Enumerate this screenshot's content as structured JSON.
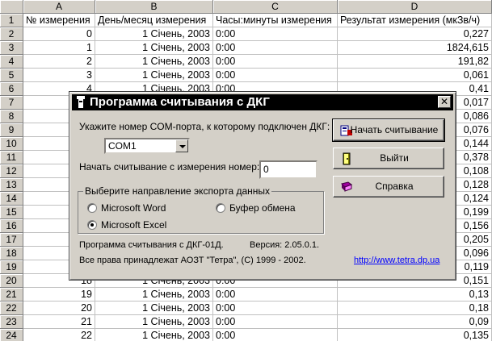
{
  "sheet": {
    "corner": "",
    "columns": [
      "A",
      "B",
      "C",
      "D"
    ],
    "headers": {
      "row_number": "1",
      "a": "№ измерения",
      "b": "День/месяц измерения",
      "c": "Часы:минуты измерения",
      "d": "Результат измерения (мкЗв/ч)"
    },
    "rows": [
      {
        "n": "2",
        "a": "0",
        "b": "1 Січень, 2003",
        "c": "0:00",
        "d": "0,227"
      },
      {
        "n": "3",
        "a": "1",
        "b": "1 Січень, 2003",
        "c": "0:00",
        "d": "1824,615"
      },
      {
        "n": "4",
        "a": "2",
        "b": "1 Січень, 2003",
        "c": "0:00",
        "d": "191,82"
      },
      {
        "n": "5",
        "a": "3",
        "b": "1 Січень, 2003",
        "c": "0:00",
        "d": "0,061"
      },
      {
        "n": "6",
        "a": "4",
        "b": "1 Січень, 2003",
        "c": "0:00",
        "d": "0,41"
      },
      {
        "n": "7",
        "a": "",
        "b": "",
        "c": "",
        "d": "0,017"
      },
      {
        "n": "8",
        "a": "",
        "b": "",
        "c": "",
        "d": "0,086"
      },
      {
        "n": "9",
        "a": "",
        "b": "",
        "c": "",
        "d": "0,076"
      },
      {
        "n": "10",
        "a": "",
        "b": "",
        "c": "",
        "d": "0,144"
      },
      {
        "n": "11",
        "a": "",
        "b": "",
        "c": "",
        "d": "0,378"
      },
      {
        "n": "12",
        "a": "",
        "b": "",
        "c": "",
        "d": "0,108"
      },
      {
        "n": "13",
        "a": "",
        "b": "",
        "c": "",
        "d": "0,128"
      },
      {
        "n": "14",
        "a": "",
        "b": "",
        "c": "",
        "d": "0,124"
      },
      {
        "n": "15",
        "a": "",
        "b": "",
        "c": "",
        "d": "0,199"
      },
      {
        "n": "16",
        "a": "",
        "b": "",
        "c": "",
        "d": "0,156"
      },
      {
        "n": "17",
        "a": "",
        "b": "",
        "c": "",
        "d": "0,205"
      },
      {
        "n": "18",
        "a": "",
        "b": "",
        "c": "",
        "d": "0,096"
      },
      {
        "n": "19",
        "a": "",
        "b": "",
        "c": "",
        "d": "0,119"
      },
      {
        "n": "20",
        "a": "18",
        "b": "1 Січень, 2003",
        "c": "0:00",
        "d": "0,151"
      },
      {
        "n": "21",
        "a": "19",
        "b": "1 Січень, 2003",
        "c": "0:00",
        "d": "0,13"
      },
      {
        "n": "22",
        "a": "20",
        "b": "1 Січень, 2003",
        "c": "0:00",
        "d": "0,18"
      },
      {
        "n": "23",
        "a": "21",
        "b": "1 Січень, 2003",
        "c": "0:00",
        "d": "0,09"
      },
      {
        "n": "24",
        "a": "22",
        "b": "1 Січень, 2003",
        "c": "0:00",
        "d": "0,135"
      }
    ]
  },
  "dialog": {
    "title": "Программа считывания с ДКГ",
    "close_label": "✕",
    "com_label": "Укажите номер COM-порта, к которому подключен ДКГ:",
    "com_value": "COM1",
    "start_label": "Начать считывание с измерения номер:",
    "start_value": "0",
    "export_group_title": "Выберите направление экспорта данных",
    "radio_word": "Microsoft Word",
    "radio_excel": "Microsoft Excel",
    "radio_clipboard": "Буфер обмена",
    "program_info": "Программа считывания с ДКГ-01Д.",
    "version": "Версия: 2.05.0.1.",
    "copyright": "Все права принадлежат АОЗТ \"Тетра\", (C) 1999 - 2002.",
    "link": "http://www.tetra.dp.ua",
    "buttons": {
      "start": "Начать считывание",
      "exit": "Выйти",
      "help": "Справка"
    },
    "selected_export": "excel"
  },
  "colors": {
    "face": "#d4d0c8",
    "titlebar": "#000000",
    "link": "#0000ff"
  }
}
